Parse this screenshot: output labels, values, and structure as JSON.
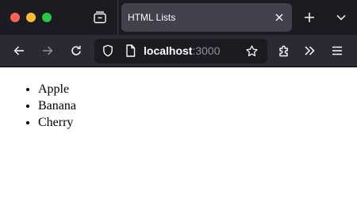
{
  "window": {
    "controls": [
      "close",
      "minimize",
      "maximize"
    ]
  },
  "tabs": [
    {
      "title": "HTML Lists",
      "active": true
    }
  ],
  "toolbar": {
    "icons": [
      "back-arrow",
      "forward-arrow",
      "reload",
      "shield",
      "page",
      "star",
      "extensions",
      "overflow-chevrons",
      "hamburger-menu"
    ]
  },
  "address_bar": {
    "host": "localhost",
    "port": ":3000"
  },
  "page": {
    "list_items": [
      "Apple",
      "Banana",
      "Cherry"
    ]
  },
  "colors": {
    "tabbar_bg": "#1c1b22",
    "navbar_bg": "#2b2a33",
    "active_tab_bg": "#42414d",
    "urlbar_bg": "#1c1b22",
    "close_dot": "#ff5f57",
    "minimize_dot": "#febc2e",
    "maximize_dot": "#28c840"
  }
}
